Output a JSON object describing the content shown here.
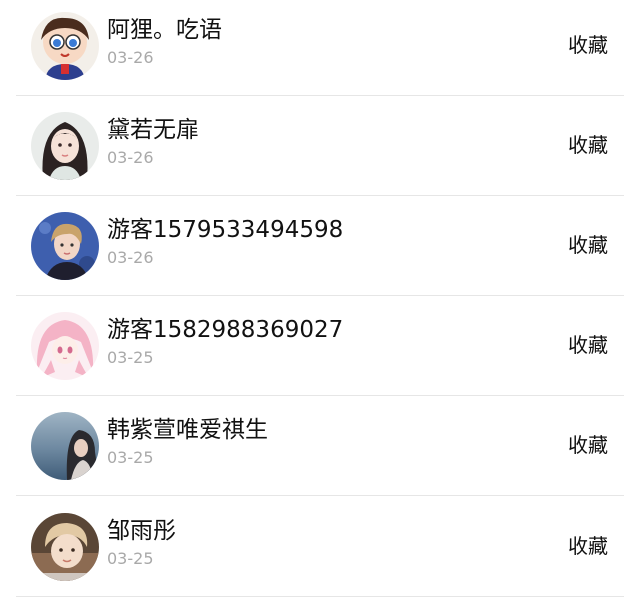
{
  "items": [
    {
      "name": "阿狸。吃语",
      "date": "03-26",
      "action": "收藏",
      "avatar": "cartoon-boy-avatar"
    },
    {
      "name": "黛若无扉",
      "date": "03-26",
      "action": "收藏",
      "avatar": "girl-portrait-avatar"
    },
    {
      "name": "游客1579533494598",
      "date": "03-26",
      "action": "收藏",
      "avatar": "boy-blue-background-avatar"
    },
    {
      "name": "游客1582988369027",
      "date": "03-25",
      "action": "收藏",
      "avatar": "anime-pink-hair-avatar"
    },
    {
      "name": "韩紫萱唯爱祺生",
      "date": "03-25",
      "action": "收藏",
      "avatar": "seaside-girl-avatar"
    },
    {
      "name": "邹雨彤",
      "date": "03-25",
      "action": "收藏",
      "avatar": "child-photo-avatar"
    }
  ]
}
